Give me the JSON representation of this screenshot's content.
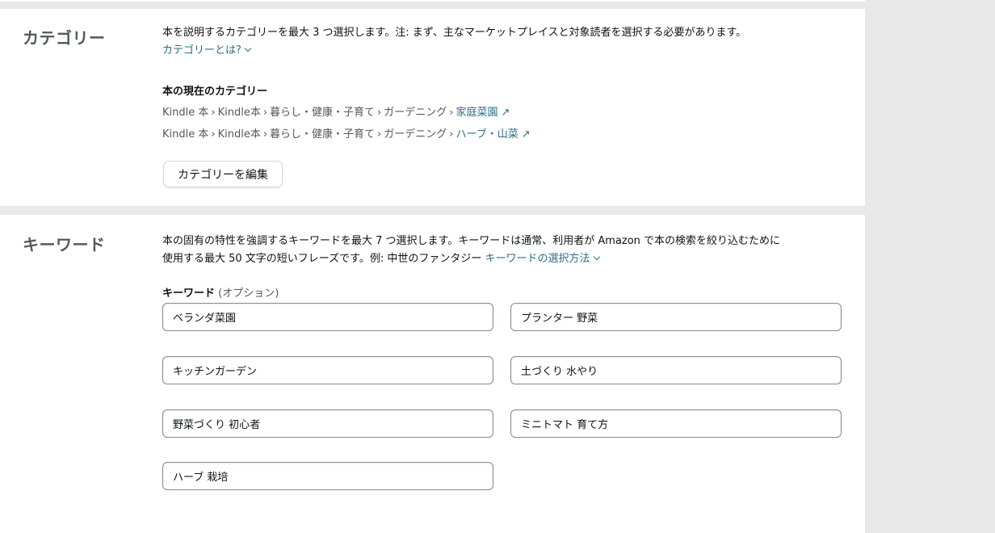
{
  "category_section": {
    "title": "カテゴリー",
    "description": "本を説明するカテゴリーを最大 3 つ選択します。注: まず、主なマーケットプレイスと対象読者を選択する必要があります。",
    "help_link": "カテゴリーとは?",
    "current_heading": "本の現在のカテゴリー",
    "paths": [
      {
        "crumbs": [
          "Kindle 本",
          "Kindle本",
          "暮らし・健康・子育て",
          "ガーデニング"
        ],
        "leaf": "家庭菜園"
      },
      {
        "crumbs": [
          "Kindle 本",
          "Kindle本",
          "暮らし・健康・子育て",
          "ガーデニング"
        ],
        "leaf": "ハーブ・山菜"
      }
    ],
    "separator": "›",
    "external_glyph": "↗",
    "edit_button": "カテゴリーを編集"
  },
  "keyword_section": {
    "title": "キーワード",
    "description_line1": "本の固有の特性を強調するキーワードを最大 7 つ選択します。キーワードは通常、利用者が Amazon で本の検索を絞り込むために",
    "description_line2": "使用する最大 50 文字の短いフレーズです。例: 中世のファンタジー",
    "help_link": "キーワードの選択方法",
    "field_label": "キーワード",
    "field_label_optional": "(オプション)",
    "keywords": [
      "ベランダ菜園",
      "プランター 野菜",
      "キッチンガーデン",
      "土づくり 水やり",
      "野菜づくり 初心者",
      "ミニトマト 育て方",
      "ハーブ 栽培"
    ]
  },
  "colors": {
    "link": "#2b6e83",
    "page_background": "#e8e8e8",
    "panel_background": "#ffffff",
    "heading_gray": "#565959"
  },
  "icons": {
    "dropdown_chevron": "chevron-down-icon",
    "external_link": "external-link-icon"
  }
}
